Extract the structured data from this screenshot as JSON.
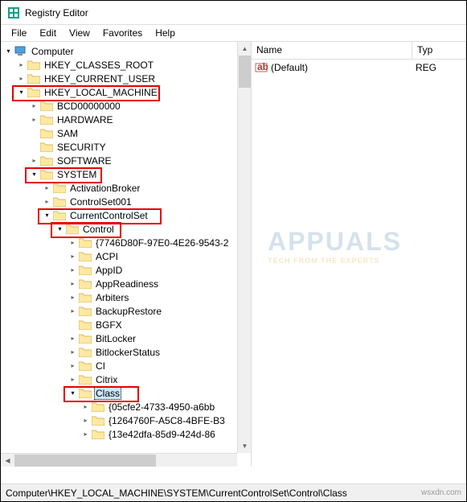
{
  "window": {
    "title": "Registry Editor"
  },
  "menu": {
    "file": "File",
    "edit": "Edit",
    "view": "View",
    "favorites": "Favorites",
    "help": "Help"
  },
  "tree": {
    "root": "Computer",
    "items": [
      "HKEY_CLASSES_ROOT",
      "HKEY_CURRENT_USER",
      "HKEY_LOCAL_MACHINE",
      "BCD00000000",
      "HARDWARE",
      "SAM",
      "SECURITY",
      "SOFTWARE",
      "SYSTEM",
      "ActivationBroker",
      "ControlSet001",
      "CurrentControlSet",
      "Control",
      "{7746D80F-97E0-4E26-9543-2",
      "ACPI",
      "AppID",
      "AppReadiness",
      "Arbiters",
      "BackupRestore",
      "BGFX",
      "BitLocker",
      "BitlockerStatus",
      "CI",
      "Citrix",
      "Class",
      "{05cfe2-4733-4950-a6bb",
      "{1264760F-A5C8-4BFE-B3",
      "{13e42dfa-85d9-424d-86"
    ]
  },
  "list": {
    "col_name": "Name",
    "col_type": "Typ",
    "row_name": "(Default)",
    "row_type": "REG"
  },
  "status": {
    "path": "Computer\\HKEY_LOCAL_MACHINE\\SYSTEM\\CurrentControlSet\\Control\\Class",
    "credit": "wsxdn.com"
  },
  "watermark": {
    "brand": "APPUALS",
    "tag": "TECH FROM THE EXPERTS"
  }
}
